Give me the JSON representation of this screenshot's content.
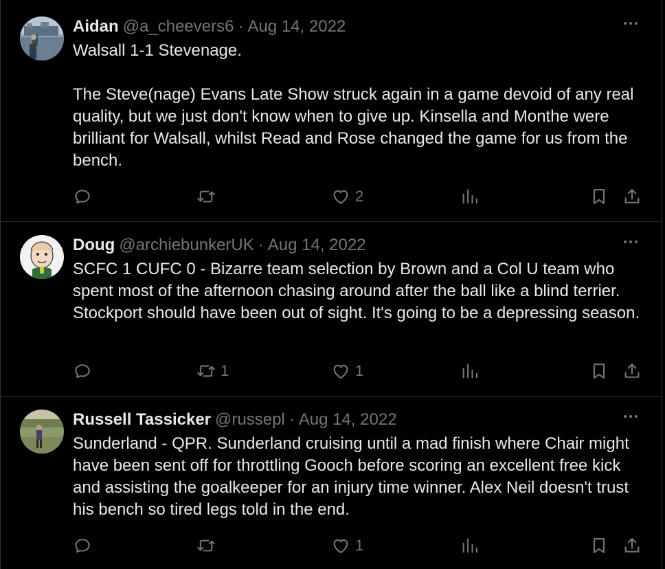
{
  "tweets": [
    {
      "name": "Aidan",
      "handle": "@a_cheevers6",
      "separator": "·",
      "date": "Aug 14, 2022",
      "paragraphs": [
        "Walsall 1-1 Stevenage.",
        "The Steve(nage) Evans Late Show struck again in a game devoid of any real quality, but we just don't know when to give up. Kinsella and Monthe were brilliant for Walsall, whilst Read and Rose changed the game for us from the bench."
      ],
      "replies": "",
      "retweets": "",
      "likes": "2"
    },
    {
      "name": "Doug",
      "handle": "@archiebunkerUK",
      "separator": "·",
      "date": "Aug 14, 2022",
      "paragraphs": [
        "SCFC 1 CUFC 0 - Bizarre team selection by Brown and a Col U team who spent most of the afternoon chasing around after the ball like a blind terrier. Stockport should have been out of sight. It's going to be a depressing season."
      ],
      "replies": "",
      "retweets": "1",
      "likes": "1"
    },
    {
      "name": "Russell Tassicker",
      "handle": "@russepl",
      "separator": "·",
      "date": "Aug 14, 2022",
      "paragraphs": [
        "Sunderland - QPR. Sunderland cruising until a mad finish where Chair might have been sent off for throttling Gooch before scoring an excellent free kick and assisting the goalkeeper for an injury time winner. Alex Neil doesn't trust his bench so tired legs told in the end."
      ],
      "replies": "",
      "retweets": "",
      "likes": "1"
    }
  ],
  "icons": {
    "reply": "reply-icon",
    "retweet": "retweet-icon",
    "like": "heart-icon",
    "views": "views-icon",
    "bookmark": "bookmark-icon",
    "share": "share-icon",
    "more": "more-icon"
  },
  "colors": {
    "background": "#000000",
    "text": "#e7e9ea",
    "muted": "#71767b",
    "divider": "#2f3336"
  }
}
